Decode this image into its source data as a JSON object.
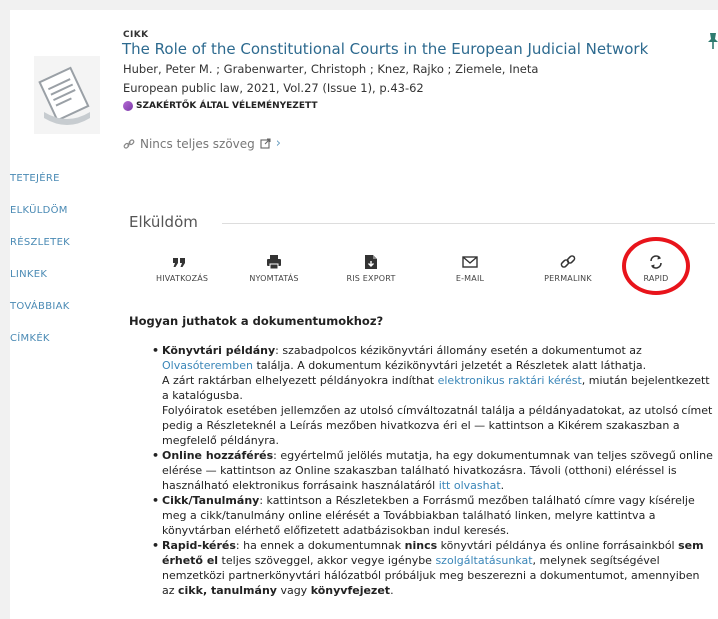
{
  "record": {
    "type_label": "CIKK",
    "title": "The Role of the Constitutional Courts in the European Judicial Network",
    "authors": "Huber, Peter M. ; Grabenwarter, Christoph ; Knez, Rajko ; Ziemele, Ineta",
    "source": "European public law, 2021, Vol.27 (Issue 1), p.43-62",
    "peer_reviewed": "SZAKÉRTŐK ÁLTAL VÉLEMÉNYEZETT",
    "no_fulltext": "Nincs teljes szöveg"
  },
  "sidenav": [
    "TETEJÉRE",
    "ELKÜLDÖM",
    "RÉSZLETEK",
    "LINKEK",
    "TOVÁBBIAK",
    "CÍMKÉK"
  ],
  "send": {
    "heading": "Elküldöm",
    "actions": [
      {
        "label": "HIVATKOZÁS",
        "icon": "quote-icon"
      },
      {
        "label": "NYOMTATÁS",
        "icon": "print-icon"
      },
      {
        "label": "RIS EXPORT",
        "icon": "file-export-icon"
      },
      {
        "label": "E-MAIL",
        "icon": "envelope-icon"
      },
      {
        "label": "PERMALINK",
        "icon": "link-icon"
      },
      {
        "label": "RAPID",
        "icon": "refresh-icon"
      }
    ],
    "highlight_color": "#e8141b"
  },
  "help": {
    "question": "Hogyan juthatok a dokumentumokhoz?",
    "items": [
      {
        "lead": "Könyvtári példány",
        "t1": ": szabadpolcos kézikönyvtári állomány esetén a dokumentumot az ",
        "link1": "Olvasóteremben",
        "t2": " találja. A dokumentum kézikönyvtári jelzetét a Részletek alatt láthatja.",
        "t3": "A zárt raktárban elhelyezett példányokra indíthat ",
        "link2": "elektronikus raktári kérést",
        "t4": ", miután bejelentkezett a katalógusba.",
        "t5": "Folyóiratok esetében jellemzően az utolsó címváltozatnál találja a példányadatokat, az utolsó címet pedig a Részleteknél a Leírás mezőben hivatkozva éri el — kattintson a Kikérem szakaszban a megfelelő példányra."
      },
      {
        "lead": "Online hozzáférés",
        "t1": ": egyértelmű jelölés mutatja, ha egy dokumentumnak van teljes szövegű online elérése — kattintson az Online szakaszban található hivatkozásra. Távoli (otthoni) eléréssel is használható elektronikus forrásaink használatáról ",
        "link1": "itt olvashat",
        "t2": "."
      },
      {
        "lead": "Cikk/Tanulmány",
        "t1": ": kattintson a Részletekben a Forrásmű mezőben található címre vagy kísérelje meg a cikk/tanulmány online elérését a Továbbiakban található linken, melyre kattintva a könyvtárban elérhető előfizetett adatbázisokban indul keresés."
      },
      {
        "lead": "Rapid-kérés",
        "t1": ": ha ennek a dokumentumnak ",
        "b1": "nincs",
        "t2": " könyvtári példánya és online forrásainkból ",
        "b2": "sem érhető el",
        "t3": " teljes szöveggel, akkor vegye igénybe ",
        "link1": "szolgáltatásunkat",
        "t4": ", melynek segítségével nemzetközi partnerkönyvtári hálózatból próbáljuk meg beszerezni a dokumentumot, amennyiben az ",
        "b3": "cikk, tanulmány",
        "t5": " vagy ",
        "b4": "könyvfejezet",
        "t6": "."
      }
    ]
  }
}
